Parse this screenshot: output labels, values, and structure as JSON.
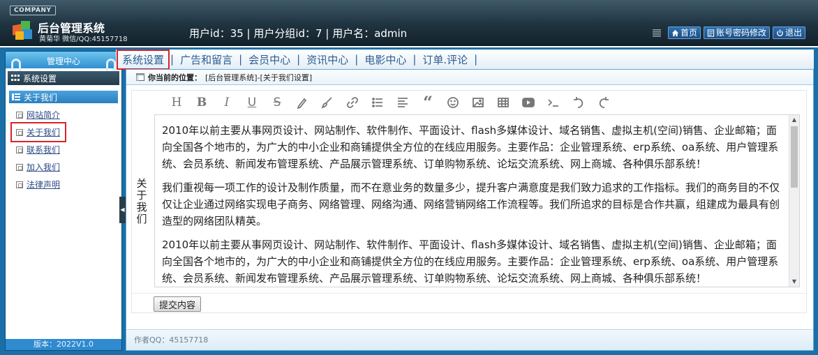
{
  "header": {
    "company": "COMPANY",
    "title": "后台管理系统",
    "subtitle": "黄菊华 微信/QQ:45157718",
    "user_info": "用户id：35 | 用户分组id：7 | 用户名：admin",
    "buttons": {
      "home": "首页",
      "account": "账号密码修改",
      "logout": "退出"
    }
  },
  "sidebar": {
    "heading": "管理中心",
    "section": "系统设置",
    "group": "关于我们",
    "items": [
      "网站简介",
      "关于我们",
      "联系我们",
      "加入我们",
      "法律声明"
    ],
    "active_index": 1,
    "version": "版本：2022V1.0"
  },
  "nav": {
    "items": [
      "系统设置",
      "广告和留言",
      "会员中心",
      "资讯中心",
      "电影中心",
      "订单.评论"
    ],
    "separator": "|",
    "active_index": 0
  },
  "location": {
    "label": "你当前的位置：",
    "value": "[后台管理系统]-[关于我们设置]"
  },
  "form": {
    "field_label": "关于我们",
    "toolbar": [
      "heading-icon",
      "bold-icon",
      "italic-icon",
      "underline-icon",
      "strikethrough-icon",
      "pen-icon",
      "brush-icon",
      "link-icon",
      "list-icon",
      "align-icon",
      "quote-icon",
      "emoji-icon",
      "image-icon",
      "table-icon",
      "video-icon",
      "code-icon",
      "undo-icon",
      "redo-icon"
    ],
    "paragraphs": [
      "2010年以前主要从事网页设计、网站制作、软件制作、平面设计、flash多媒体设计、域名销售、虚拟主机(空间)销售、企业邮箱；面向全国各个地市的，为广大的中小企业和商铺提供全方位的在线应用服务。主要作品：企业管理系统、erp系统、oa系统、用户管理系统、会员系统、新闻发布管理系统、产品展示管理系统、订单购物系统、论坛交流系统、网上商城、各种俱乐部系统！",
      "我们重视每一项工作的设计及制作质量，而不在意业务的数量多少，提升客户满意度是我们致力追求的工作指标。我们的商务目的不仅仅让企业通过网络实现电子商务、网络管理、网络沟通、网络营销网络工作流程等。我们所追求的目标是合作共赢，组建成为最具有创造型的网络团队精英。",
      "2010年以前主要从事网页设计、网站制作、软件制作、平面设计、flash多媒体设计、域名销售、虚拟主机(空间)销售、企业邮箱；面向全国各个地市的，为广大的中小企业和商铺提供全方位的在线应用服务。主要作品：企业管理系统、erp系统、oa系统、用户管理系统、会员系统、新闻发布管理系统、产品展示管理系统、订单购物系统、论坛交流系统、网上商城、各种俱乐部系统！"
    ],
    "submit_label": "提交内容"
  },
  "footer": {
    "author": "作者QQ：45157718"
  },
  "colors": {
    "band": "#1a6fa7",
    "active_outline": "#d8232a",
    "nav_text": "#2e5c93"
  }
}
